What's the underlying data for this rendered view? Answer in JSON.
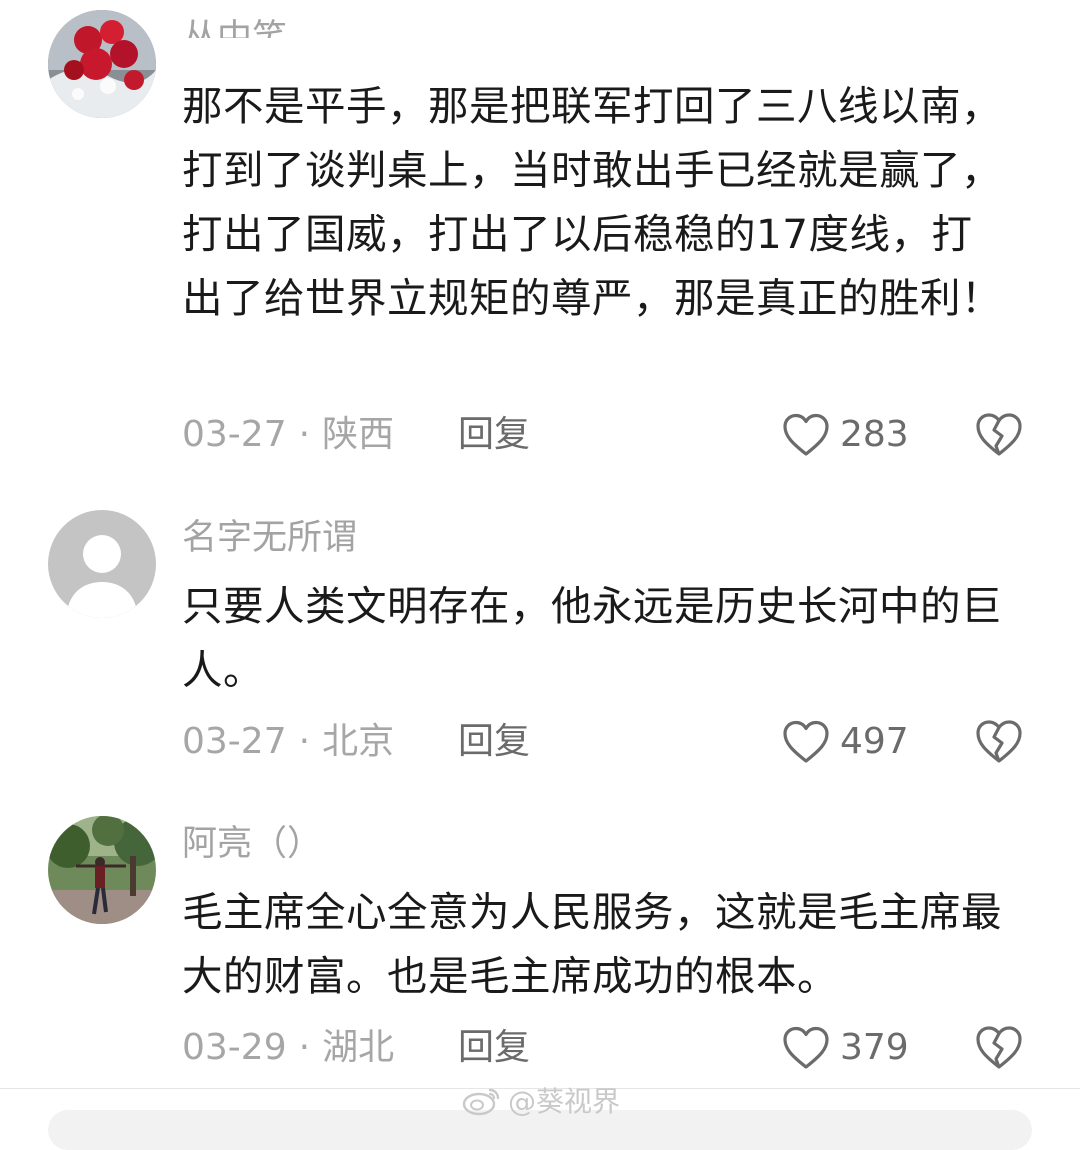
{
  "comments": [
    {
      "username": "丛中笑",
      "text": "那不是平手，那是把联军打回了三八线以南，打到了谈判桌上，当时敢出手已经就是赢了，打出了国威，打出了以后稳稳的17度线，打出了给世界立规矩的尊严，那是真正的胜利！",
      "date": "03-27",
      "separator": "·",
      "location": "陕西",
      "reply_label": "回复",
      "likes": "283"
    },
    {
      "username": "名字无所谓",
      "text": "只要人类文明存在，他永远是历史长河中的巨人。",
      "date": "03-27",
      "separator": "·",
      "location": "北京",
      "reply_label": "回复",
      "likes": "497"
    },
    {
      "username": "阿亮（）",
      "text": "毛主席全心全意为人民服务，这就是毛主席最大的财富。也是毛主席成功的根本。",
      "date": "03-29",
      "separator": "·",
      "location": "湖北",
      "reply_label": "回复",
      "likes": "379"
    }
  ],
  "watermark": "@葵视界",
  "icons": {
    "like": "heart-outline-icon",
    "dislike": "broken-heart-icon",
    "watermark": "weibo-icon"
  },
  "colors": {
    "text": "#1a1a1a",
    "muted": "#a6a6a6",
    "action": "#6b6b6b"
  }
}
